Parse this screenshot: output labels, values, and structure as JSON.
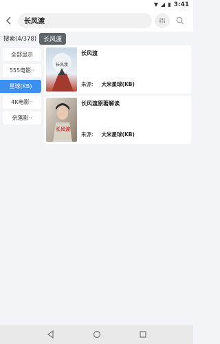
{
  "status_bar": {
    "time": "3:41"
  },
  "header": {
    "search_query": "长风渡"
  },
  "sub_header": {
    "count": "搜索(4/378)",
    "keyword": "长风渡"
  },
  "sidebar": {
    "items": [
      {
        "label": "全部显示"
      },
      {
        "label": "555电影··"
      },
      {
        "label": "星球(KB)"
      },
      {
        "label": "4K电影··"
      },
      {
        "label": "奈落影··"
      }
    ]
  },
  "results": [
    {
      "title": "长风渡",
      "source_label": "来源:",
      "source_value": "大米星球(KB)",
      "poster_text": "长风渡"
    },
    {
      "title": "长风渡原著解读",
      "source_label": "来源:",
      "source_value": "大米星球(KB)",
      "poster_text": "长风渡"
    }
  ],
  "colors": {
    "accent": "#3a8ff0",
    "chip": "#5f6468"
  }
}
